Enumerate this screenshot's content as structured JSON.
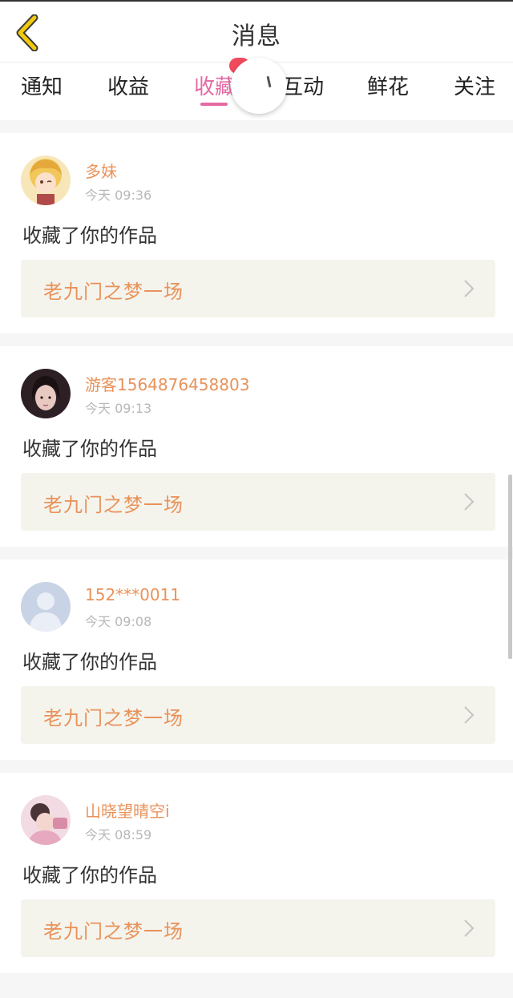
{
  "header": {
    "title": "消息",
    "back_icon": "chevron-left-icon",
    "back_icon_color": "#f2c90d"
  },
  "tabs": [
    {
      "label": "通知"
    },
    {
      "label": "收益"
    },
    {
      "label": "收藏",
      "active": true
    },
    {
      "label": "互动"
    },
    {
      "label": "鲜花"
    },
    {
      "label": "关注"
    }
  ],
  "colors": {
    "accent_pink": "#e66aa3",
    "name_orange": "#e9925a",
    "badge_red": "#f04a5d"
  },
  "messages": [
    {
      "username": "多妹",
      "time": "今天 09:36",
      "action": "收藏了你的作品",
      "work_title": "老九门之梦一场"
    },
    {
      "username": "游客1564876458803",
      "time": "今天 09:13",
      "action": "收藏了你的作品",
      "work_title": "老九门之梦一场"
    },
    {
      "username": "152***0011",
      "time": "今天 09:08",
      "action": "收藏了你的作品",
      "work_title": "老九门之梦一场"
    },
    {
      "username": "山晓望晴空i",
      "time": "今天 08:59",
      "action": "收藏了你的作品",
      "work_title": "老九门之梦一场"
    }
  ]
}
